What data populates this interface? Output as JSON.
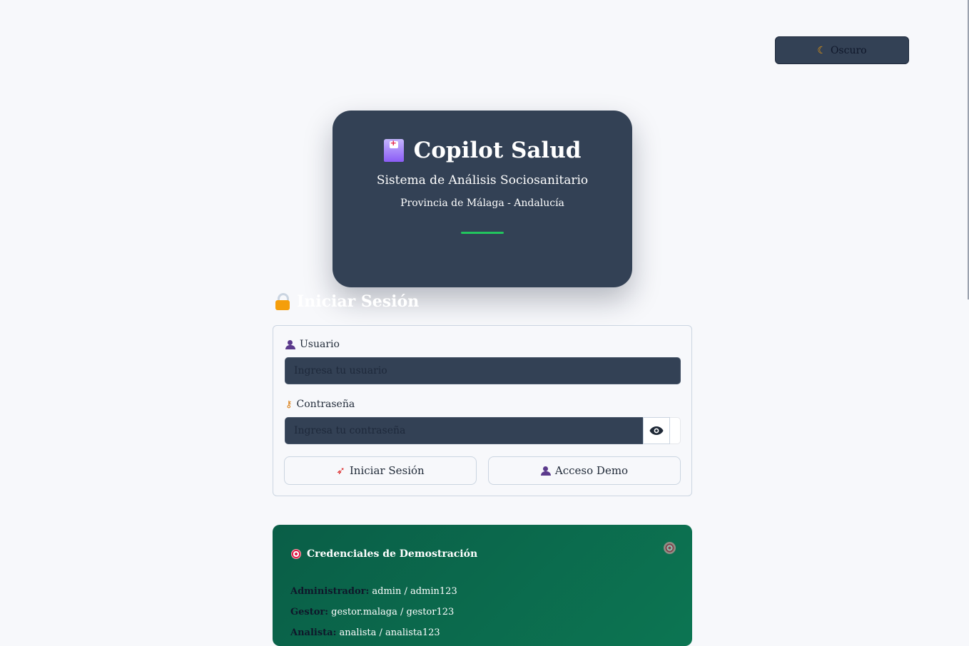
{
  "theme_toggle": {
    "icon": "moon-icon",
    "label": "Oscuro"
  },
  "hero": {
    "icon": "hospital-icon",
    "title": "Copilot Salud",
    "subtitle": "Sistema de Análisis Sociosanitario",
    "region": "Provincia de Málaga - Andalucía",
    "accent_color": "#22c55e"
  },
  "login": {
    "heading_icon": "lock-icon",
    "heading": "Iniciar Sesión",
    "username_label": "Usuario",
    "username_placeholder": "Ingresa tu usuario",
    "password_label": "Contraseña",
    "password_placeholder": "Ingresa tu contraseña",
    "toggle_visibility_icon": "eye-icon",
    "submit_label": "Iniciar Sesión",
    "demo_label": "Acceso Demo"
  },
  "demo_credentials": {
    "title": "Credenciales de Demostración",
    "icon": "target-icon",
    "rows": [
      {
        "role": "Administrador:",
        "value": "admin / admin123"
      },
      {
        "role": "Gestor:",
        "value": "gestor.malaga / gestor123"
      },
      {
        "role": "Analista:",
        "value": "analista / analista123"
      }
    ]
  },
  "colors": {
    "background": "#f7f8fb",
    "panel": "#334155",
    "demo_green": "#0c7552"
  }
}
